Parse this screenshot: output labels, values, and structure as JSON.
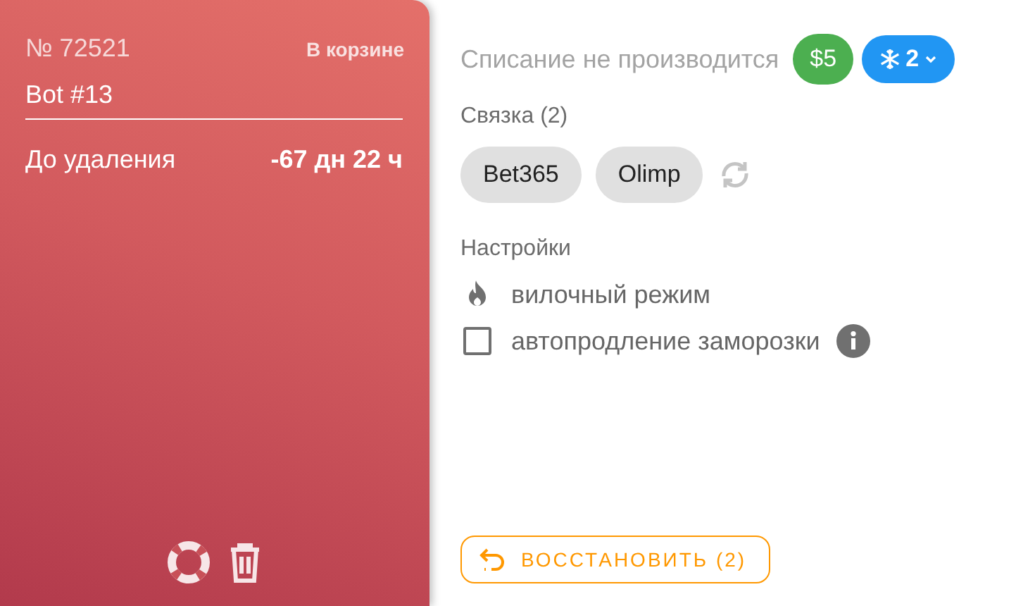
{
  "card": {
    "number": "№ 72521",
    "status": "В корзине",
    "name": "Bot #13",
    "countdown_label": "До удаления",
    "countdown_value": "-67 дн 22 ч"
  },
  "billing": {
    "text": "Списание не производится",
    "price": "$5",
    "freeze_count": "2"
  },
  "bundle": {
    "title": "Связка (2)",
    "items": [
      "Bet365",
      "Olimp"
    ]
  },
  "settings": {
    "title": "Настройки",
    "items": [
      {
        "kind": "mode",
        "label": "вилочный режим"
      },
      {
        "kind": "checkbox",
        "label": "автопродление заморозки",
        "checked": false
      }
    ]
  },
  "restore_button": "ВОССТАНОВИТЬ (2)"
}
